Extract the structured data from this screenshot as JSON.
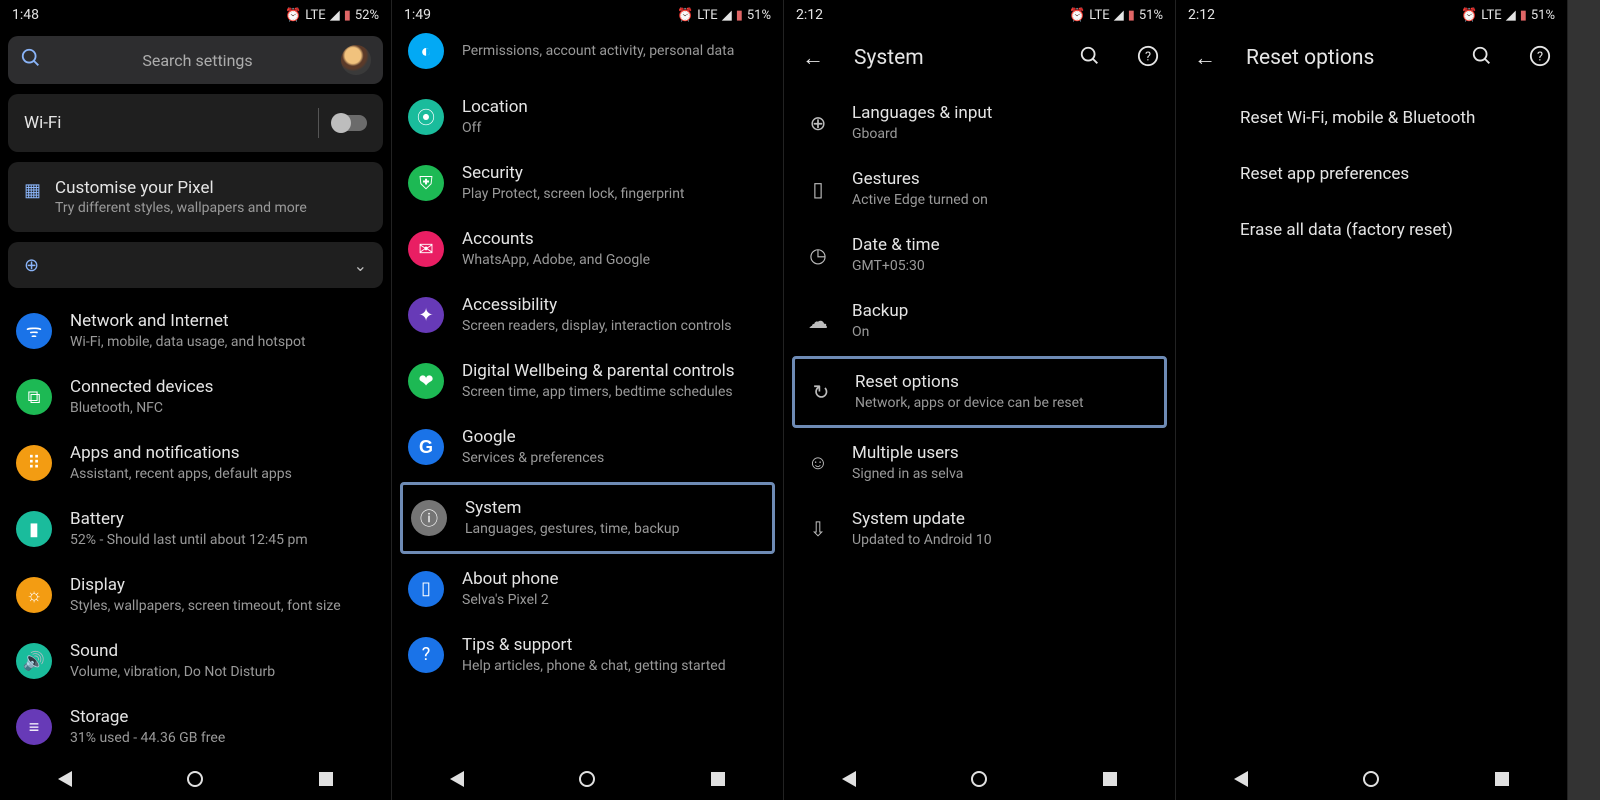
{
  "screens": [
    {
      "status": {
        "time": "1:48",
        "net": "LTE",
        "battery": "52%"
      },
      "search_placeholder": "Search settings",
      "wifi": {
        "label": "Wi-Fi"
      },
      "customise": {
        "title": "Customise your Pixel",
        "sub": "Try different styles, wallpapers and more"
      },
      "items": [
        {
          "title": "Network and Internet",
          "sub": "Wi-Fi, mobile, data usage, and hotspot"
        },
        {
          "title": "Connected devices",
          "sub": "Bluetooth, NFC"
        },
        {
          "title": "Apps and notifications",
          "sub": "Assistant, recent apps, default apps"
        },
        {
          "title": "Battery",
          "sub": "52% - Should last until about 12:45 pm"
        },
        {
          "title": "Display",
          "sub": "Styles, wallpapers, screen timeout, font size"
        },
        {
          "title": "Sound",
          "sub": "Volume, vibration, Do Not Disturb"
        },
        {
          "title": "Storage",
          "sub": "31% used - 44.36 GB free"
        }
      ]
    },
    {
      "status": {
        "time": "1:49",
        "net": "LTE",
        "battery": "51%"
      },
      "items": [
        {
          "title": "",
          "sub": "Permissions, account activity, personal data"
        },
        {
          "title": "Location",
          "sub": "Off"
        },
        {
          "title": "Security",
          "sub": "Play Protect, screen lock, fingerprint"
        },
        {
          "title": "Accounts",
          "sub": "WhatsApp, Adobe, and Google"
        },
        {
          "title": "Accessibility",
          "sub": "Screen readers, display, interaction controls"
        },
        {
          "title": "Digital Wellbeing & parental controls",
          "sub": "Screen time, app timers, bedtime schedules"
        },
        {
          "title": "Google",
          "sub": "Services & preferences"
        },
        {
          "title": "System",
          "sub": "Languages, gestures, time, backup"
        },
        {
          "title": "About phone",
          "sub": "Selva's Pixel 2"
        },
        {
          "title": "Tips & support",
          "sub": "Help articles, phone & chat, getting started"
        }
      ]
    },
    {
      "status": {
        "time": "2:12",
        "net": "LTE",
        "battery": "51%"
      },
      "header": "System",
      "items": [
        {
          "title": "Languages & input",
          "sub": "Gboard"
        },
        {
          "title": "Gestures",
          "sub": "Active Edge turned on"
        },
        {
          "title": "Date & time",
          "sub": "GMT+05:30"
        },
        {
          "title": "Backup",
          "sub": "On"
        },
        {
          "title": "Reset options",
          "sub": "Network, apps or device can be reset"
        },
        {
          "title": "Multiple users",
          "sub": "Signed in as selva"
        },
        {
          "title": "System update",
          "sub": "Updated to Android 10"
        }
      ]
    },
    {
      "status": {
        "time": "2:12",
        "net": "LTE",
        "battery": "51%"
      },
      "header": "Reset options",
      "items": [
        {
          "title": "Reset Wi-Fi, mobile & Bluetooth"
        },
        {
          "title": "Reset app preferences"
        },
        {
          "title": "Erase all data (factory reset)"
        }
      ]
    }
  ]
}
